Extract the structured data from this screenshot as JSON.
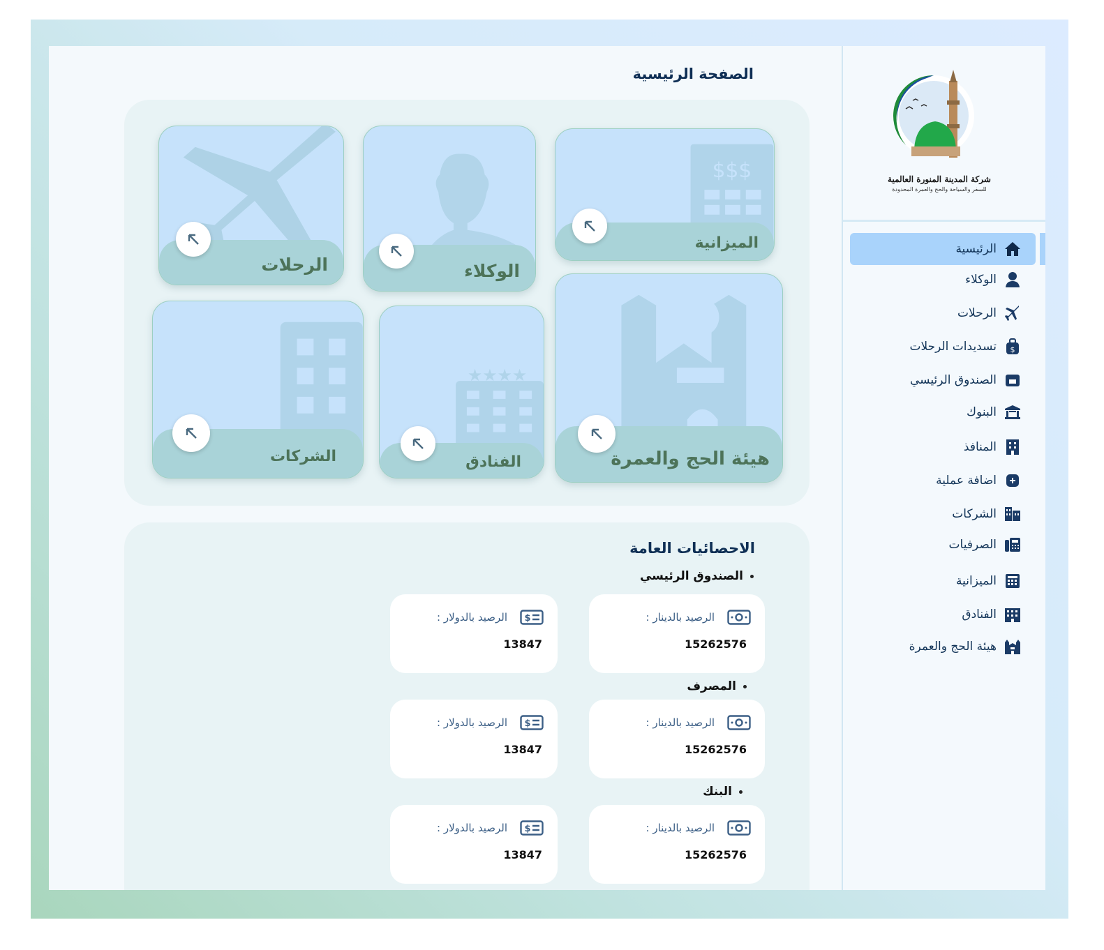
{
  "page": {
    "title": "الصفحة الرئيسية"
  },
  "logo": {
    "name": "شركة المدينة المنورة العالمية",
    "tagline": "للسفر والسياحة والحج والعمرة المحدودة"
  },
  "sidebar": {
    "items": [
      {
        "label": "الرئيسية",
        "icon": "home-icon",
        "active": true
      },
      {
        "label": "الوكلاء",
        "icon": "agent-icon"
      },
      {
        "label": "الرحلات",
        "icon": "plane-icon"
      },
      {
        "label": "تسديدات الرحلات",
        "icon": "money-bag-icon"
      },
      {
        "label": "الصندوق الرئيسي",
        "icon": "cash-register-icon"
      },
      {
        "label": "البنوك",
        "icon": "bank-icon"
      },
      {
        "label": "المنافذ",
        "icon": "building-icon"
      },
      {
        "label": "اضافة عملية",
        "icon": "plus-box-icon"
      },
      {
        "label": "الشركات",
        "icon": "city-icon"
      },
      {
        "label": "الصرفيات",
        "icon": "fax-icon"
      },
      {
        "label": "الميزانية",
        "icon": "calculator-icon"
      },
      {
        "label": "الفنادق",
        "icon": "hotel-icon"
      },
      {
        "label": "هيئة الحج والعمرة",
        "icon": "kaaba-icon"
      }
    ]
  },
  "tiles": {
    "trips": "الرحلات",
    "agents": "الوكلاء",
    "budget": "الميزانية",
    "companies": "الشركات",
    "hotels": "الفنادق",
    "hajj": "هيئة الحج والعمرة"
  },
  "stats": {
    "title": "الاحصائيات العامة",
    "sections": [
      {
        "title": "الصندوق الرئيسي",
        "dinar_label": "الرصيد بالدينار :",
        "dinar_value": "15262576",
        "dollar_label": "الرصيد بالدولار :",
        "dollar_value": "13847"
      },
      {
        "title": "المصرف",
        "dinar_label": "الرصيد بالدينار :",
        "dinar_value": "15262576",
        "dollar_label": "الرصيد بالدولار :",
        "dollar_value": "13847"
      },
      {
        "title": "البنك",
        "dinar_label": "الرصيد بالدينار :",
        "dinar_value": "15262576",
        "dollar_label": "الرصيد بالدولار :",
        "dollar_value": "13847"
      }
    ]
  },
  "colors": {
    "accent": "#a9d3fb",
    "tile_bg": "#c6e2fb",
    "tile_band": "#a9d3d8",
    "tile_text": "#4d7359",
    "nav_text": "#123458"
  }
}
